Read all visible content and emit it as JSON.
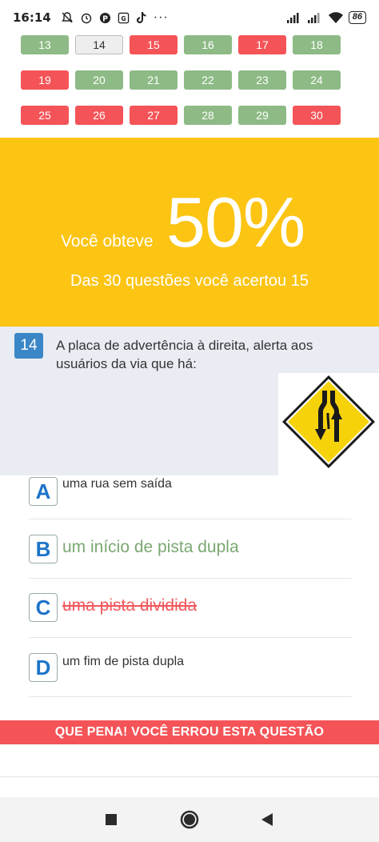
{
  "status_bar": {
    "time": "16:14",
    "battery": "86"
  },
  "grid": {
    "rows": [
      [
        {
          "n": "13",
          "state": "green"
        },
        {
          "n": "14",
          "state": "neutral"
        },
        {
          "n": "15",
          "state": "red"
        },
        {
          "n": "16",
          "state": "green"
        },
        {
          "n": "17",
          "state": "red"
        },
        {
          "n": "18",
          "state": "green"
        }
      ],
      [
        {
          "n": "19",
          "state": "red"
        },
        {
          "n": "20",
          "state": "green"
        },
        {
          "n": "21",
          "state": "green"
        },
        {
          "n": "22",
          "state": "green"
        },
        {
          "n": "23",
          "state": "green"
        },
        {
          "n": "24",
          "state": "green"
        }
      ],
      [
        {
          "n": "25",
          "state": "red"
        },
        {
          "n": "26",
          "state": "red"
        },
        {
          "n": "27",
          "state": "red"
        },
        {
          "n": "28",
          "state": "green"
        },
        {
          "n": "29",
          "state": "green"
        },
        {
          "n": "30",
          "state": "red"
        }
      ]
    ]
  },
  "result": {
    "prefix": "Você obteve",
    "percent": "50%",
    "summary": "Das 30 questões você acertou 15"
  },
  "question": {
    "number": "14",
    "text": "A placa de advertência à direita, alerta aos usuários da via que há:"
  },
  "answers": [
    {
      "letter": "A",
      "text": "uma rua sem saída",
      "state": "normal"
    },
    {
      "letter": "B",
      "text": "um início de pista dupla",
      "state": "correct"
    },
    {
      "letter": "C",
      "text": "uma pista dividida",
      "state": "wrong"
    },
    {
      "letter": "D",
      "text": "um fim de pista dupla",
      "state": "normal"
    }
  ],
  "feedback": "QUE PENA! VOCÊ ERROU ESTA QUESTÃO",
  "colors": {
    "green": "#8dba85",
    "red": "#f45458",
    "yellow": "#fcc413",
    "blue": "#3a86c6"
  }
}
